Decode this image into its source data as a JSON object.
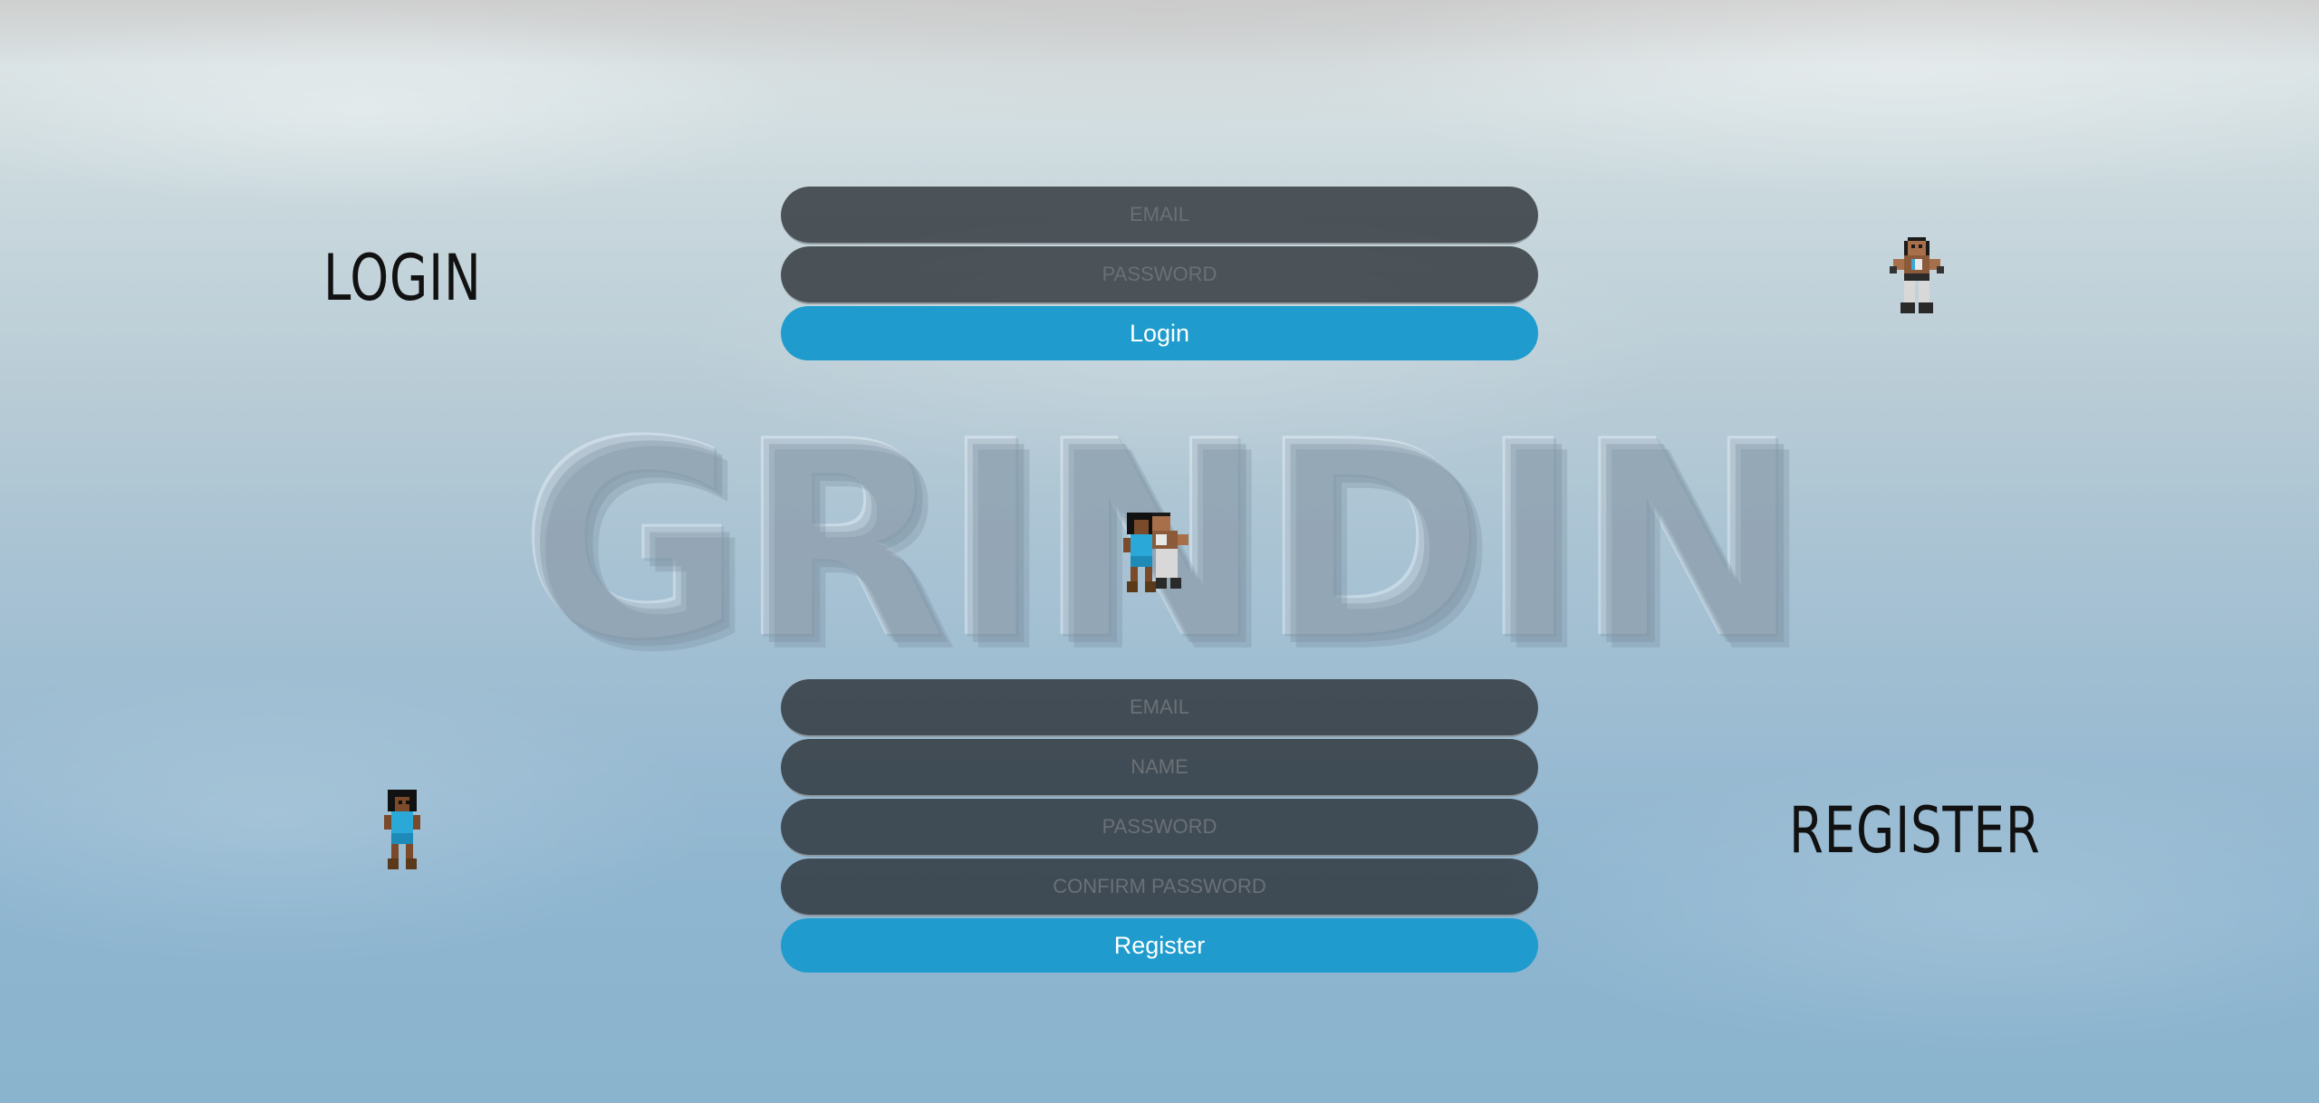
{
  "background_logo": "GRINDIN",
  "login": {
    "title": "LOGIN",
    "email_placeholder": "EMAIL",
    "password_placeholder": "PASSWORD",
    "button_label": "Login"
  },
  "register": {
    "title": "REGISTER",
    "email_placeholder": "EMAIL",
    "name_placeholder": "NAME",
    "password_placeholder": "PASSWORD",
    "confirm_password_placeholder": "CONFIRM PASSWORD",
    "button_label": "Register"
  },
  "colors": {
    "button": "#1f9ccd",
    "field": "#2d3237",
    "title_text": "#111111"
  },
  "icons": {
    "login_sprite": "fighter-male-sprite-icon",
    "register_sprite": "fighter-female-sprite-icon",
    "center_sprite": "fighter-duo-sprite-icon"
  }
}
